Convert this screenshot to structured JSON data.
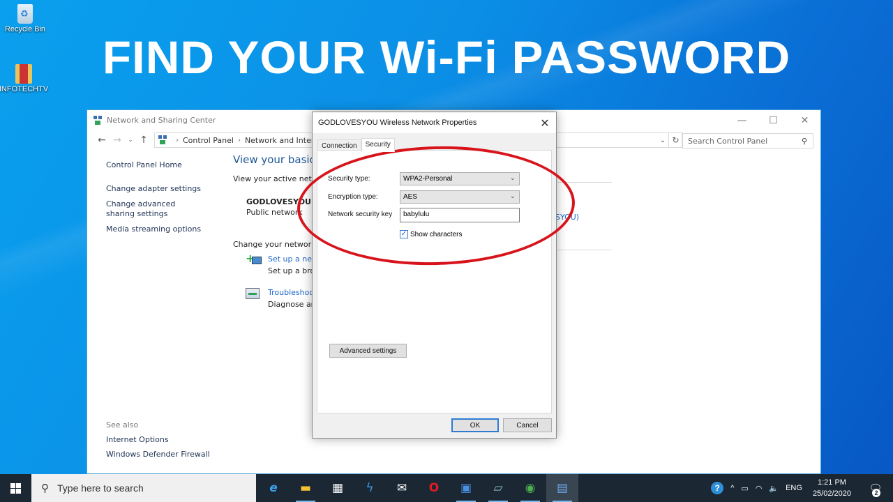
{
  "desktop": {
    "icons": [
      {
        "label": "Recycle Bin",
        "icon": "recycle-bin-icon"
      },
      {
        "label": "INFOTECHTV",
        "icon": "folder-icon"
      }
    ],
    "headline": "FIND YOUR Wi-Fi PASSWORD"
  },
  "window": {
    "title": "Network and Sharing Center",
    "controls": {
      "minimize": "—",
      "maximize": "☐",
      "close": "✕"
    },
    "nav": {
      "back": "←",
      "forward": "→",
      "recent": "⌄",
      "up": "↑"
    },
    "breadcrumb": [
      "Control Panel",
      "Network and Internet"
    ],
    "breadcrumb_sep": "›",
    "address_dropdown": "⌄",
    "refresh": "↻",
    "search": {
      "placeholder": "Search Control Panel",
      "icon": "⚲"
    },
    "sidebar": {
      "items": [
        {
          "label": "Control Panel Home"
        },
        {
          "label": "Change adapter settings"
        },
        {
          "label": "Change advanced sharing settings"
        },
        {
          "label": "Media streaming options"
        }
      ],
      "see_also": {
        "header": "See also",
        "items": [
          {
            "label": "Internet Options"
          },
          {
            "label": "Windows Defender Firewall"
          }
        ]
      }
    },
    "main": {
      "title": "View your basic n",
      "active_networks_label": "View your active netw",
      "network_name": "GODLOVESYOU",
      "network_type": "Public network",
      "connection_link_fragment": "SYOU)",
      "change_settings_label": "Change your networkin",
      "tasks": [
        {
          "link": "Set up a new",
          "desc": "Set up a broa"
        },
        {
          "link": "Troubleshoot",
          "desc": "Diagnose and"
        }
      ]
    }
  },
  "dialog": {
    "title": "GODLOVESYOU Wireless Network Properties",
    "close": "✕",
    "tabs": [
      {
        "label": "Connection",
        "active": false
      },
      {
        "label": "Security",
        "active": true
      }
    ],
    "security_type_label": "Security type:",
    "security_type_value": "WPA2-Personal",
    "encryption_type_label": "Encryption type:",
    "encryption_type_value": "AES",
    "key_label": "Network security key",
    "key_value": "babylulu",
    "show_characters_label": "Show characters",
    "show_characters_checked": true,
    "check_glyph": "✓",
    "chevron": "⌄",
    "advanced_button": "Advanced settings",
    "ok_button": "OK",
    "cancel_button": "Cancel"
  },
  "annotation": {
    "color": "#d7141c"
  },
  "taskbar": {
    "search_placeholder": "Type here to search",
    "search_icon": "⚲",
    "apps": [
      {
        "name": "internet-explorer",
        "glyph": "e",
        "color": "#3ca0e8"
      },
      {
        "name": "file-explorer",
        "glyph": "▬",
        "color": "#f2c232"
      },
      {
        "name": "microsoft-store",
        "glyph": "▦",
        "color": "#ffffff"
      },
      {
        "name": "app-lightning",
        "glyph": "ϟ",
        "color": "#3a9ae8"
      },
      {
        "name": "mail",
        "glyph": "✉",
        "color": "#ffffff"
      },
      {
        "name": "opera",
        "glyph": "O",
        "color": "#e01b24"
      },
      {
        "name": "app-window",
        "glyph": "▣",
        "color": "#4a90e2"
      },
      {
        "name": "notepad",
        "glyph": "▱",
        "color": "#8fb6c8"
      },
      {
        "name": "chrome",
        "glyph": "◉",
        "color": "#4caf50"
      },
      {
        "name": "control-panel",
        "glyph": "▤",
        "color": "#6aa8e8"
      }
    ],
    "tray": {
      "help": "?",
      "chevron": "^",
      "battery": "▭",
      "wifi": "◠",
      "volume": "🔈",
      "language": "ENG",
      "time": "1:21 PM",
      "date": "25/02/2020",
      "notifications": "🗨",
      "notification_count": "2"
    }
  }
}
